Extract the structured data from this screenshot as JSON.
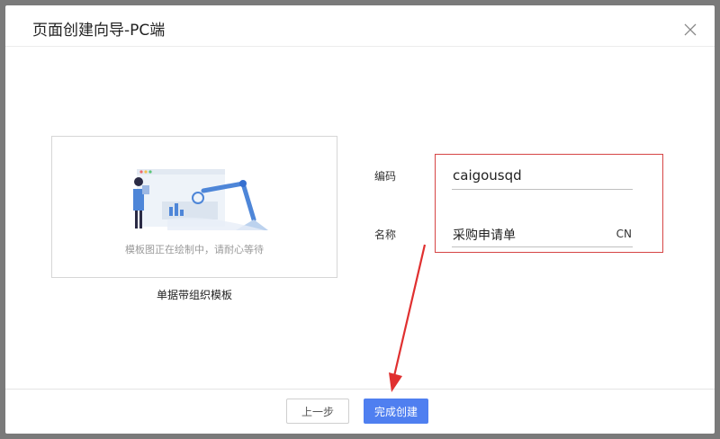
{
  "dialog": {
    "title": "页面创建向导-PC端",
    "close_icon": "close-icon"
  },
  "preview": {
    "loading_text": "模板图正在绘制中，请耐心等待",
    "template_name": "单据带组织模板"
  },
  "form": {
    "code_label": "编码",
    "code_value": "caigousqd",
    "name_label": "名称",
    "name_value": "采购申请单",
    "name_suffix": "CN"
  },
  "footer": {
    "prev_label": "上一步",
    "finish_label": "完成创建"
  },
  "colors": {
    "primary": "#4f7ff0",
    "annotation_red": "#e03030"
  }
}
